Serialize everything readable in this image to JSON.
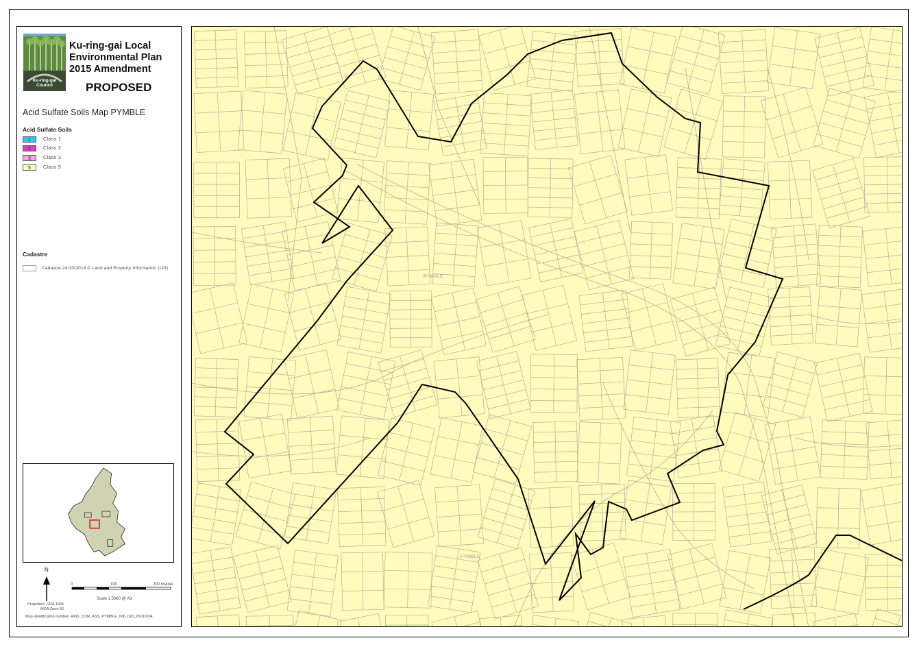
{
  "header": {
    "title_line1": "Ku-ring-gai Local",
    "title_line2": "Environmental Plan",
    "title_line3": "2015 Amendment",
    "status": "PROPOSED",
    "logo_text_1": "Ku-ring-gai",
    "logo_text_2": "Council"
  },
  "map_title": "Acid Sulfate Soils Map PYMBLE",
  "legend": {
    "acid_heading": "Acid Sulfate Soils",
    "classes": [
      {
        "code": "1",
        "label": "Class 1",
        "color": "#33c6e8"
      },
      {
        "code": "2",
        "label": "Class 2",
        "color": "#e839c4"
      },
      {
        "code": "3",
        "label": "Class 3",
        "color": "#f2a6e6"
      },
      {
        "code": "5",
        "label": "Class 5",
        "color": "#fffbbd"
      }
    ],
    "cadastre_heading": "Cadastre",
    "cadastre_label": "Cadastre 24/10/2018 © Land and Property Information (LPI)"
  },
  "scalebar": {
    "north": "N",
    "tick0": "0",
    "tick1": "100",
    "tick2": "200 metres",
    "scale_text": "Scale   1:5060   @ A3",
    "projection_line1": "Projection: GDA 1994",
    "projection_line2": "MGA Zone 56"
  },
  "map_identification": "Map identification number:    4900_COM_ASS_PYMBLE_006_020_20181004",
  "places": {
    "label1": "PYMBLE",
    "label2": "PYMBLE"
  },
  "colors": {
    "map_fill": "#fffbbd",
    "boundary": "#000000",
    "cadastre": "#b3ae96",
    "inset_fill": "#d1d2b2",
    "inset_highlight": "#e00000"
  }
}
